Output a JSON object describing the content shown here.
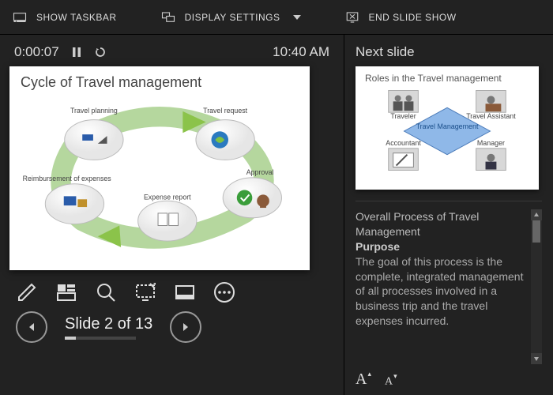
{
  "topbar": {
    "show_taskbar": "SHOW TASKBAR",
    "display_settings": "DISPLAY SETTINGS",
    "end_slide_show": "END SLIDE SHOW"
  },
  "timer": {
    "elapsed": "0:00:07",
    "clock": "10:40 AM"
  },
  "current_slide": {
    "title": "Cycle of Travel management",
    "nodes": {
      "planning": "Travel planning",
      "request": "Travel request",
      "approval": "Approval",
      "report": "Expense report",
      "reimbursement": "Reimbursement of expenses"
    }
  },
  "slide_counter": {
    "text": "Slide 2 of 13",
    "current": 2,
    "total": 13
  },
  "next_slide_header": "Next slide",
  "next_slide": {
    "title": "Roles in the Travel management",
    "center": "Travel Management",
    "roles": {
      "traveler": "Traveler",
      "assistant": "Travel Assistant",
      "manager": "Manager",
      "accountant": "Accountant"
    }
  },
  "notes": {
    "title": "Overall Process of Travel Management",
    "purpose_label": "Purpose",
    "body": "The goal of this process is the complete, integrated management of all processes involved in a business trip and the travel expenses incurred."
  }
}
